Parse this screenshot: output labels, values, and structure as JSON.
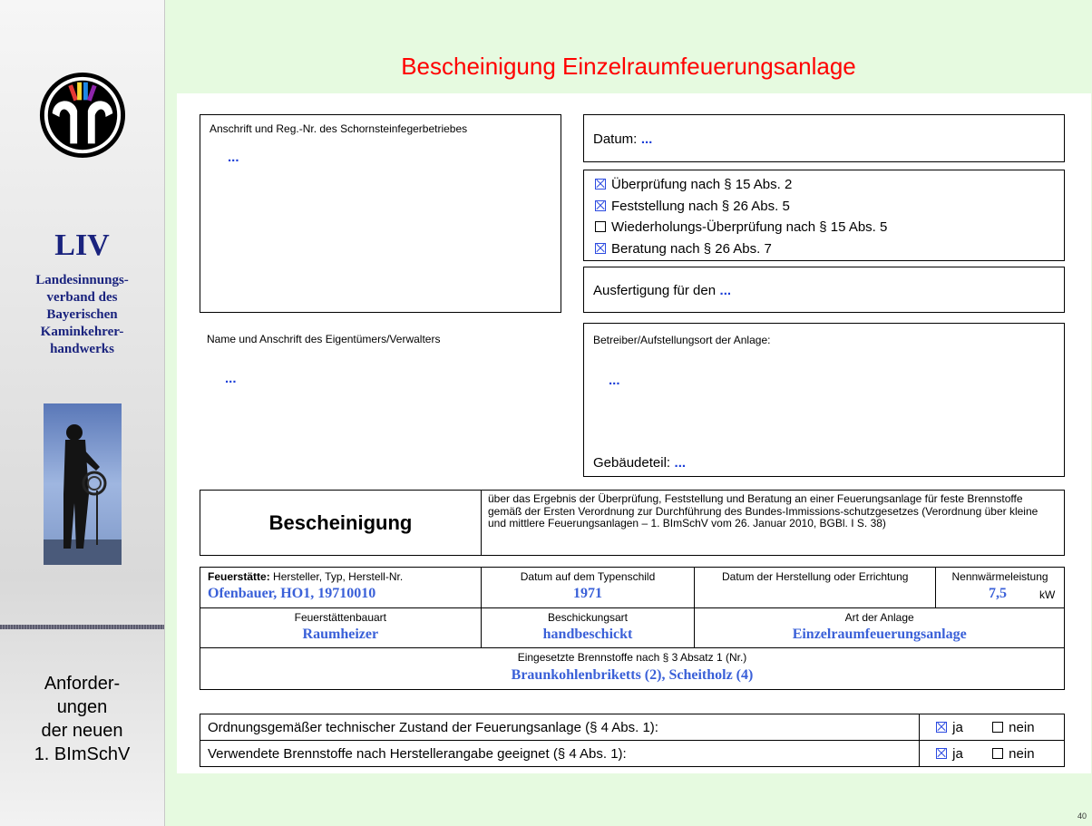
{
  "sidebar": {
    "org_short": "LIV",
    "org_line1": "Landesinnungs-",
    "org_line2": "verband des",
    "org_line3": "Bayerischen",
    "org_line4": "Kaminkehrer-",
    "org_line5": "handwerks",
    "anf_line1": "Anforder-",
    "anf_line2": "ungen",
    "anf_line3": "der neuen",
    "anf_line4": "1. BImSchV"
  },
  "slide": {
    "title": "Bescheinigung Einzelraumfeuerungsanlage",
    "page_number": "40"
  },
  "form": {
    "address_label": "Anschrift und Reg.-Nr. des Schornsteinfegerbetriebes",
    "address_value": "...",
    "datum_label": "Datum:",
    "datum_value": "...",
    "checks": [
      {
        "label": "Überprüfung nach § 15 Abs. 2",
        "checked": true
      },
      {
        "label": "Feststellung nach § 26 Abs. 5",
        "checked": true
      },
      {
        "label": "Wiederholungs-Überprüfung nach § 15 Abs. 5",
        "checked": false
      },
      {
        "label": "Beratung nach § 26 Abs. 7",
        "checked": true
      }
    ],
    "ausfertigung_label": "Ausfertigung für den",
    "ausfertigung_value": "...",
    "owner_label": "Name und Anschrift des Eigentümers/Verwalters",
    "owner_value": "...",
    "operator_label": "Betreiber/Aufstellungsort der Anlage:",
    "operator_value": "...",
    "gebaeude_label": "Gebäudeteil:",
    "gebaeude_value": "...",
    "cert_title": "Bescheinigung",
    "cert_text": "über das Ergebnis der Überprüfung, Feststellung und Beratung an einer Feuerungsanlage für feste Brennstoffe gemäß der Ersten Verordnung zur Durchführung des Bundes-Immissions-schutzgesetzes (Verordnung über kleine und mittlere Feuerungsanlagen – 1. BImSchV vom 26. Januar 2010, BGBl. I S. 38)",
    "table": {
      "h_feuerstaette_bold": "Feuerstätte:",
      "h_feuerstaette_rest": " Hersteller, Typ, Herstell-Nr.",
      "h_datum_typenschild": "Datum auf dem Typenschild",
      "h_datum_herstellung": "Datum der Herstellung oder Errichtung",
      "h_nennwaerme": "Nennwärmeleistung",
      "v_feuerstaette": "Ofenbauer, HO1, 19710010",
      "v_datum_typenschild": "1971",
      "v_datum_herstellung": "",
      "v_nennwaerme": "7,5",
      "v_unit": "kW",
      "h_bauart": "Feuerstättenbauart",
      "h_beschickung": "Beschickungsart",
      "h_art": "Art der Anlage",
      "v_bauart": "Raumheizer",
      "v_beschickung": "handbeschickt",
      "v_art": "Einzelraumfeuerungsanlage",
      "h_brennstoffe": "Eingesetzte Brennstoffe nach § 3 Absatz 1 (Nr.)",
      "v_brennstoffe": "Braunkohlenbriketts (2), Scheitholz (4)"
    },
    "assessments": [
      {
        "label": "Ordnungsgemäßer technischer Zustand der Feuerungsanlage (§ 4 Abs. 1):",
        "yes": "ja",
        "no": "nein",
        "value": "ja"
      },
      {
        "label": "Verwendete Brennstoffe nach Herstellerangabe geeignet (§ 4 Abs. 1):",
        "yes": "ja",
        "no": "nein",
        "value": "ja"
      }
    ]
  },
  "colors": {
    "title": "#ff0000",
    "sidebar_text": "#1a237e",
    "value_blue": "#3a60d8",
    "slide_bg": "#e6fae0"
  }
}
